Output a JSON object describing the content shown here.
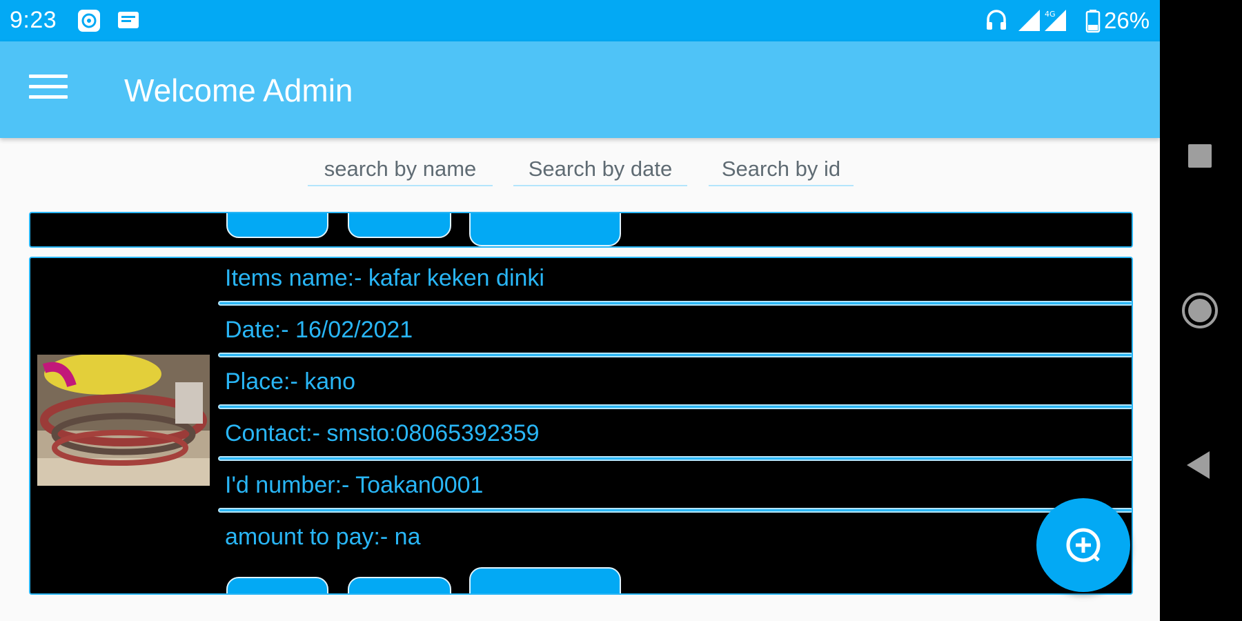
{
  "status_bar": {
    "time": "9:23",
    "battery": "26%",
    "icons": [
      "gallery-icon",
      "message-icon",
      "headset-icon",
      "signal-icon",
      "lte-signal-icon",
      "battery-icon"
    ]
  },
  "app_bar": {
    "title": "Welcome Admin",
    "menu_icon": "hamburger-menu-icon"
  },
  "search": {
    "by_name_placeholder": "search by name",
    "by_date_placeholder": "Search by date",
    "by_id_placeholder": "Search by id"
  },
  "record": {
    "items_name": "Items name:- kafar keken dinki",
    "date": "Date:- 16/02/2021",
    "place": "Place:- kano",
    "contact": "Contact:- smsto:08065392359",
    "id_number": "I'd number:- Toakan0001",
    "amount": "amount to pay:- na"
  },
  "fab": {
    "icon": "add-circle-icon"
  },
  "nav_bar": {
    "icons": [
      "recents-square-icon",
      "home-circle-icon",
      "back-triangle-icon"
    ]
  },
  "colors": {
    "status_bar": "#03a9f4",
    "app_bar": "#4fc3f7",
    "accent": "#29b6f6",
    "card_bg": "#000000",
    "fab": "#03a9f4"
  }
}
